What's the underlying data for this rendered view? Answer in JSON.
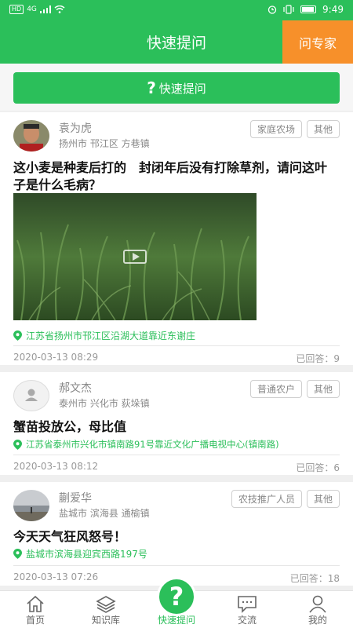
{
  "status": {
    "network": "4G",
    "hd": "HD",
    "time": "9:49"
  },
  "header": {
    "title": "快速提问",
    "expert_label": "问专家"
  },
  "ask_button": {
    "icon": "?",
    "label": "快速提问"
  },
  "posts": [
    {
      "name": "袁为虎",
      "location": "扬州市 邗江区 方巷镇",
      "tags": [
        "家庭农场",
        "其他"
      ],
      "title": "这小麦是种麦后打的　封闭年后没有打除草剂，请问这叶子是什么毛病？",
      "address": "江苏省扬州市邗江区沿湖大道靠近东谢庄",
      "time": "2020-03-13 08:29",
      "answers": "已回答：9"
    },
    {
      "name": "郝文杰",
      "location": "泰州市 兴化市 荻垛镇",
      "tags": [
        "普通农户",
        "其他"
      ],
      "title": "蟹苗投放公，母比值",
      "address": "江苏省泰州市兴化市镇南路91号靠近文化广播电视中心(镇南路)",
      "time": "2020-03-13 08:12",
      "answers": "已回答：6"
    },
    {
      "name": "蒯爱华",
      "location": "盐城市 滨海县 通榆镇",
      "tags": [
        "农技推广人员",
        "其他"
      ],
      "title": "今天天气狂风怒号！",
      "address": "盐城市滨海县迎宾西路197号",
      "time": "2020-03-13 07:26",
      "answers": "已回答：18"
    }
  ],
  "tabs": [
    {
      "label": "首页",
      "icon": "home-icon"
    },
    {
      "label": "知识库",
      "icon": "layers-icon"
    },
    {
      "label": "快速提问",
      "icon": "question-icon"
    },
    {
      "label": "交流",
      "icon": "chat-icon"
    },
    {
      "label": "我的",
      "icon": "user-icon"
    }
  ],
  "colors": {
    "primary": "#2bbf5a",
    "accent": "#f7902a"
  }
}
